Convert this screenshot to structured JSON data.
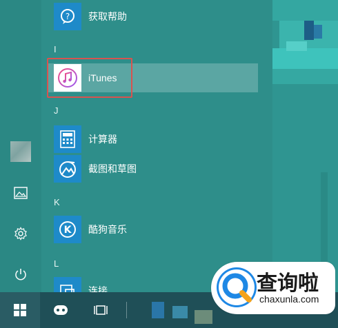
{
  "sections": [
    {
      "letter": "I"
    },
    {
      "letter": "J"
    },
    {
      "letter": "K"
    },
    {
      "letter": "L"
    }
  ],
  "apps": {
    "tips": {
      "label": "获取帮助",
      "icon": "help-chat-icon"
    },
    "itunes": {
      "label": "iTunes",
      "icon": "itunes-music-note-icon"
    },
    "calculator": {
      "label": "计算器",
      "icon": "calculator-icon"
    },
    "snip": {
      "label": "截图和草图",
      "icon": "snip-sketch-icon"
    },
    "kugou": {
      "label": "酷狗音乐",
      "icon": "kugou-k-icon"
    },
    "connect": {
      "label": "连接",
      "icon": "connect-icon"
    }
  },
  "rail": {
    "icons": [
      "user-avatar",
      "photos-icon",
      "settings-gear-icon",
      "power-icon"
    ]
  },
  "taskbar": {
    "icons": [
      "windows-start-icon",
      "cortana-icon",
      "task-view-icon"
    ]
  },
  "watermark": {
    "cn": "查询啦",
    "en": "chaxunla.com"
  },
  "colors": {
    "start_bg": "#2e8e8a",
    "tile_blue": "#1e8ac9",
    "highlight_red": "#d9534f",
    "taskbar": "#1f4f57"
  }
}
